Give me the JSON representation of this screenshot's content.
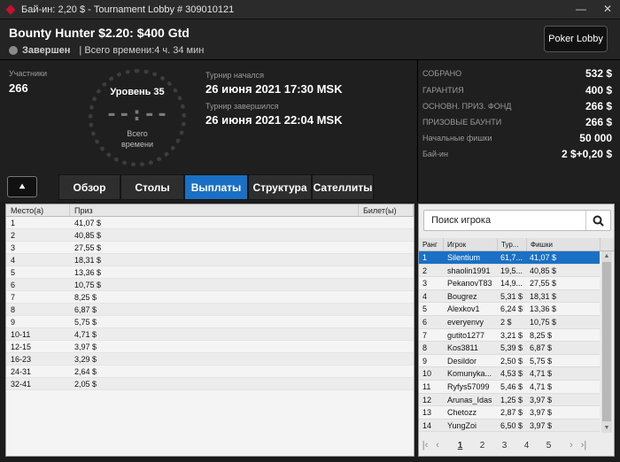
{
  "window": {
    "title": "Бай-ин: 2,20 $ - Tournament Lobby # 309010121",
    "minimize": "—",
    "close": "✕"
  },
  "header": {
    "name": "Bounty Hunter $2.20: $400 Gtd",
    "status": "Завершен",
    "total_time": "| Всего времени:4 ч. 34 мин",
    "poker_lobby": "Poker Lobby"
  },
  "info": {
    "participants_label": "Участники",
    "participants": "266",
    "level": "Уровень 35",
    "clock": "--:--",
    "clock_sub_1": "Всего",
    "clock_sub_2": "времени",
    "started_label": "Турнир начался",
    "started": "26 июня 2021  17:30 MSK",
    "ended_label": "Турнир завершился",
    "ended": "26 июня 2021  22:04 MSK"
  },
  "stats": [
    {
      "k": "СОБРАНО",
      "v": "532 $"
    },
    {
      "k": "ГАРАНТИЯ",
      "v": "400 $"
    },
    {
      "k": "ОСНОВН. ПРИЗ. ФОНД",
      "v": "266 $"
    },
    {
      "k": "ПРИЗОВЫЕ БАУНТИ",
      "v": "266 $"
    },
    {
      "k": "Начальные фишки",
      "v": "50 000"
    },
    {
      "k": "Бай-ин",
      "v": "2 $+0,20 $"
    }
  ],
  "tabs": [
    "Обзор",
    "Столы",
    "Выплаты",
    "Структура",
    "Сателлиты"
  ],
  "active_tab": 2,
  "payout": {
    "headers": [
      "Место(а)",
      "Приз",
      "Билет(ы)"
    ],
    "rows": [
      [
        "1",
        "41,07 $"
      ],
      [
        "2",
        "40,85 $"
      ],
      [
        "3",
        "27,55 $"
      ],
      [
        "4",
        "18,31 $"
      ],
      [
        "5",
        "13,36 $"
      ],
      [
        "6",
        "10,75 $"
      ],
      [
        "7",
        "8,25 $"
      ],
      [
        "8",
        "6,87 $"
      ],
      [
        "9",
        "5,75 $"
      ],
      [
        "10-11",
        "4,71 $"
      ],
      [
        "12-15",
        "3,97 $"
      ],
      [
        "16-23",
        "3,29 $"
      ],
      [
        "24-31",
        "2,64 $"
      ],
      [
        "32-41",
        "2,05 $"
      ]
    ]
  },
  "players": {
    "search_placeholder": "Поиск игрока",
    "headers": [
      "Ранг",
      "Игрок",
      "Тур...",
      "Фишки"
    ],
    "rows": [
      [
        "1",
        "Silentium",
        "61,7...",
        "41,07 $"
      ],
      [
        "2",
        "shaolin1991",
        "19,5...",
        "40,85 $"
      ],
      [
        "3",
        "PekanovT83",
        "14,9...",
        "27,55 $"
      ],
      [
        "4",
        "Bougrez",
        "5,31 $",
        "18,31 $"
      ],
      [
        "5",
        "Alexkov1",
        "6,24 $",
        "13,36 $"
      ],
      [
        "6",
        "everyenvy",
        "2 $",
        "10,75 $"
      ],
      [
        "7",
        "gutito1277",
        "3,21 $",
        "8,25 $"
      ],
      [
        "8",
        "Kos3811",
        "5,39 $",
        "6,87 $"
      ],
      [
        "9",
        "Desildor",
        "2,50 $",
        "5,75 $"
      ],
      [
        "10",
        "Komunyka...",
        "4,53 $",
        "4,71 $"
      ],
      [
        "11",
        "Ryfys57099",
        "5,46 $",
        "4,71 $"
      ],
      [
        "12",
        "Arunas_Idas",
        "1,25 $",
        "3,97 $"
      ],
      [
        "13",
        "Chetozz",
        "2,87 $",
        "3,97 $"
      ],
      [
        "14",
        "YungZoi",
        "6,50 $",
        "3,97 $"
      ]
    ],
    "pages": [
      "1",
      "2",
      "3",
      "4",
      "5"
    ]
  }
}
